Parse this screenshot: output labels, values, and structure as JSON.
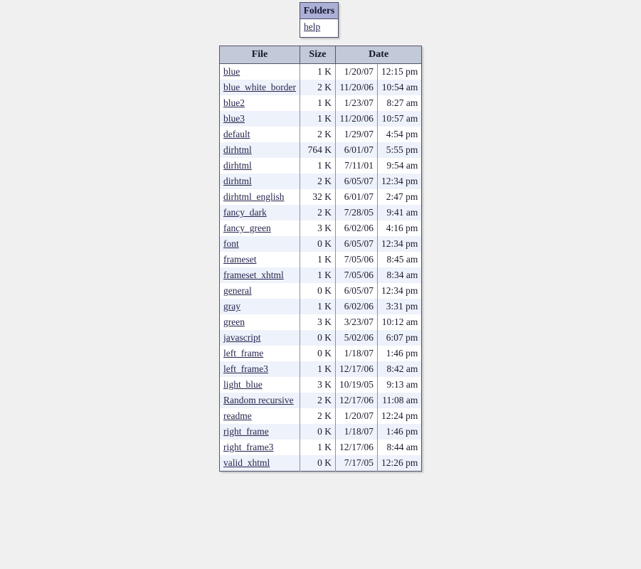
{
  "page": {
    "background_color": "#f0f0f0",
    "link_color": "#26264f"
  },
  "folders_panel": {
    "title": "Folders",
    "header_bg": "#adb0d6",
    "links": [
      {
        "label": "help",
        "name": "folder-link-help"
      }
    ]
  },
  "file_table": {
    "header_bg": "#c2c9d8",
    "alt_row_bg": "#eef2fa",
    "columns": [
      "File",
      "Size",
      "Date"
    ],
    "rows": [
      {
        "file": "blue",
        "size": "1 K",
        "date": "1/20/07",
        "time": "12:15 pm"
      },
      {
        "file": "blue_white_border",
        "size": "2 K",
        "date": "11/20/06",
        "time": "10:54 am"
      },
      {
        "file": "blue2",
        "size": "1 K",
        "date": "1/23/07",
        "time": "8:27 am"
      },
      {
        "file": "blue3",
        "size": "1 K",
        "date": "11/20/06",
        "time": "10:57 am"
      },
      {
        "file": "default",
        "size": "2 K",
        "date": "1/29/07",
        "time": "4:54 pm"
      },
      {
        "file": "dirhtml",
        "size": "764 K",
        "date": "6/01/07",
        "time": "5:55 pm"
      },
      {
        "file": "dirhtml",
        "size": "1 K",
        "date": "7/11/01",
        "time": "9:54 am"
      },
      {
        "file": "dirhtml",
        "size": "2 K",
        "date": "6/05/07",
        "time": "12:34 pm"
      },
      {
        "file": "dirhtml_english",
        "size": "32 K",
        "date": "6/01/07",
        "time": "2:47 pm"
      },
      {
        "file": "fancy_dark",
        "size": "2 K",
        "date": "7/28/05",
        "time": "9:41 am"
      },
      {
        "file": "fancy_green",
        "size": "3 K",
        "date": "6/02/06",
        "time": "4:16 pm"
      },
      {
        "file": "font",
        "size": "0 K",
        "date": "6/05/07",
        "time": "12:34 pm"
      },
      {
        "file": "frameset",
        "size": "1 K",
        "date": "7/05/06",
        "time": "8:45 am"
      },
      {
        "file": "frameset_xhtml",
        "size": "1 K",
        "date": "7/05/06",
        "time": "8:34 am"
      },
      {
        "file": "general",
        "size": "0 K",
        "date": "6/05/07",
        "time": "12:34 pm"
      },
      {
        "file": "gray",
        "size": "1 K",
        "date": "6/02/06",
        "time": "3:31 pm"
      },
      {
        "file": "green",
        "size": "3 K",
        "date": "3/23/07",
        "time": "10:12 am"
      },
      {
        "file": "javascript",
        "size": "0 K",
        "date": "5/02/06",
        "time": "6:07 pm"
      },
      {
        "file": "left_frame",
        "size": "0 K",
        "date": "1/18/07",
        "time": "1:46 pm"
      },
      {
        "file": "left_frame3",
        "size": "1 K",
        "date": "12/17/06",
        "time": "8:42 am"
      },
      {
        "file": "light_blue",
        "size": "3 K",
        "date": "10/19/05",
        "time": "9:13 am"
      },
      {
        "file": "Random recursive",
        "size": "2 K",
        "date": "12/17/06",
        "time": "11:08 am"
      },
      {
        "file": "readme",
        "size": "2 K",
        "date": "1/20/07",
        "time": "12:24 pm"
      },
      {
        "file": "right_frame",
        "size": "0 K",
        "date": "1/18/07",
        "time": "1:46 pm"
      },
      {
        "file": "right_frame3",
        "size": "1 K",
        "date": "12/17/06",
        "time": "8:44 am"
      },
      {
        "file": "valid_xhtml",
        "size": "0 K",
        "date": "7/17/05",
        "time": "12:26 pm"
      }
    ]
  }
}
